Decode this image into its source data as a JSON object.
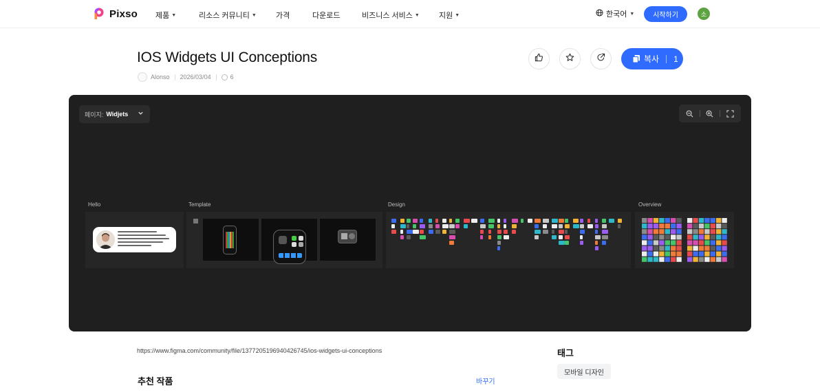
{
  "header": {
    "brand": "Pixso",
    "nav": [
      {
        "label": "제품",
        "caret": true
      },
      {
        "label": "리소스 커뮤니티",
        "caret": true
      },
      {
        "label": "가격",
        "caret": false
      },
      {
        "label": "다운로드",
        "caret": false
      },
      {
        "label": "비즈니스 서비스",
        "caret": true
      },
      {
        "label": "지원",
        "caret": true
      }
    ],
    "language": "한국어",
    "start_button": "시작하기",
    "avatar_initial": "소"
  },
  "file": {
    "title": "IOS Widgets UI Conceptions",
    "author": "Alonso",
    "date": "2026/03/04",
    "views": "6",
    "copy_label": "복사",
    "copy_count": "1"
  },
  "canvas": {
    "page_label": "페이지:",
    "page_name": "Widjets",
    "frames": [
      {
        "label": "Hello"
      },
      {
        "label": "Template"
      },
      {
        "label": "Design"
      },
      {
        "label": "Overview"
      }
    ]
  },
  "source_url": "https://www.figma.com/community/file/1377205196940426745/ios-widgets-ui-conceptions",
  "tags": {
    "heading": "태그",
    "items": [
      "모바일 디자인"
    ]
  },
  "recommended": {
    "heading": "추천 작품",
    "change_label": "바꾸기"
  },
  "colors": {
    "accent": "#2f6bff",
    "canvas_bg": "#1f1f1f",
    "logo_pink": "#f0428a"
  },
  "icons": {
    "like": "thumbs-up-icon",
    "favorite": "star-icon",
    "share": "share-icon",
    "copy": "copy-icon",
    "globe": "globe-icon",
    "zoom_out": "zoom-out-icon",
    "zoom_in": "zoom-in-icon",
    "fullscreen": "fullscreen-icon",
    "views": "eye-icon"
  }
}
